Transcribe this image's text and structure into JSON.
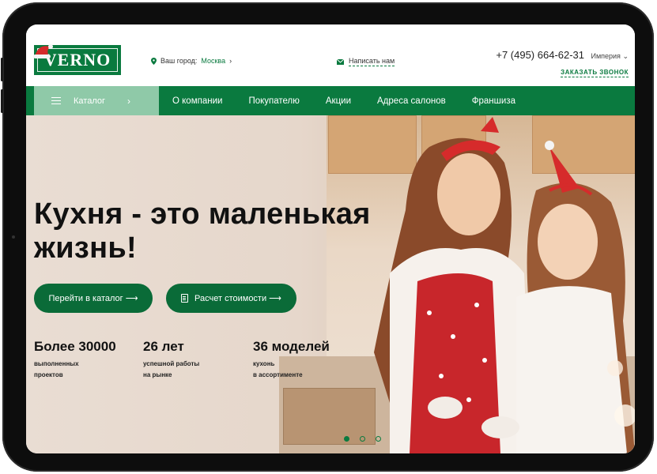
{
  "header": {
    "logo_text": "VERNO",
    "city_label": "Ваш город:",
    "city_value": "Москва",
    "mail_label": "Написать нам",
    "phone": "+7 (495) 664-62-31",
    "region": "Империя",
    "callback": "ЗАКАЗАТЬ ЗВОНОК"
  },
  "nav": {
    "catalog": "Каталог",
    "links": [
      "О компании",
      "Покупателю",
      "Акции",
      "Адреса салонов",
      "Франшиза"
    ]
  },
  "hero": {
    "title_line1": "Кухня - это маленькая",
    "title_line2": "жизнь!",
    "btn_catalog": "Перейти в каталог ⟶",
    "btn_calc": "Расчет стоимости ⟶",
    "stats": [
      {
        "big": "Более 30000",
        "small1": "выполненных",
        "small2": "проектов"
      },
      {
        "big": "26 лет",
        "small1": "успешной работы",
        "small2": "на рынке"
      },
      {
        "big": "36 моделей",
        "small1": "кухонь",
        "small2": "в ассортименте"
      }
    ],
    "slider": {
      "count": 3,
      "active": 1
    }
  },
  "colors": {
    "brand": "#0a7a3f",
    "catalog_bg": "#8fc9a8",
    "button": "#0a6b38"
  }
}
